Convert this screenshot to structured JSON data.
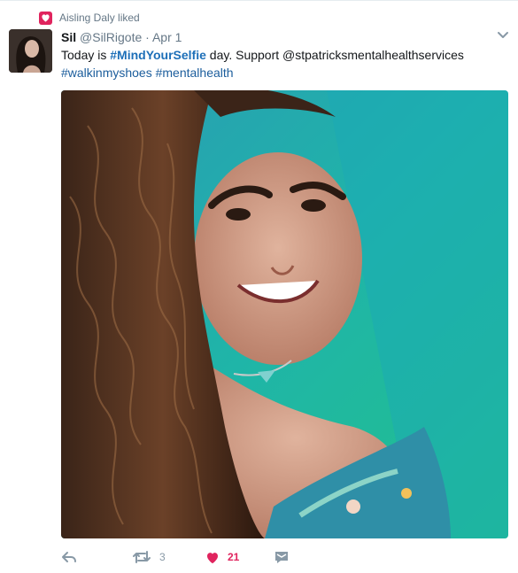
{
  "social_context": {
    "text": "Aisling Daly liked",
    "icon": "heart-icon",
    "color": "#e0245e"
  },
  "tweet": {
    "display_name": "Sil",
    "handle": "@SilRigote",
    "separator": "·",
    "timestamp": "Apr 1",
    "text_prefix": "Today is ",
    "hashtag_bold": "#MindYourSelfie",
    "text_middle": " day. Support ",
    "mention": "@stpatricksmentalhealthservices",
    "hashtag_1": "#walkinmyshoes",
    "hashtag_2": "#mentalhealth"
  },
  "actions": {
    "reply_icon": "reply-icon",
    "retweet_icon": "retweet-icon",
    "retweet_count": "3",
    "like_icon": "heart-icon",
    "like_count": "21",
    "like_color": "#e0245e",
    "dm_icon": "envelope-icon"
  },
  "colors": {
    "link": "#1b5d9c",
    "muted": "#657786",
    "action": "#8899a6"
  }
}
